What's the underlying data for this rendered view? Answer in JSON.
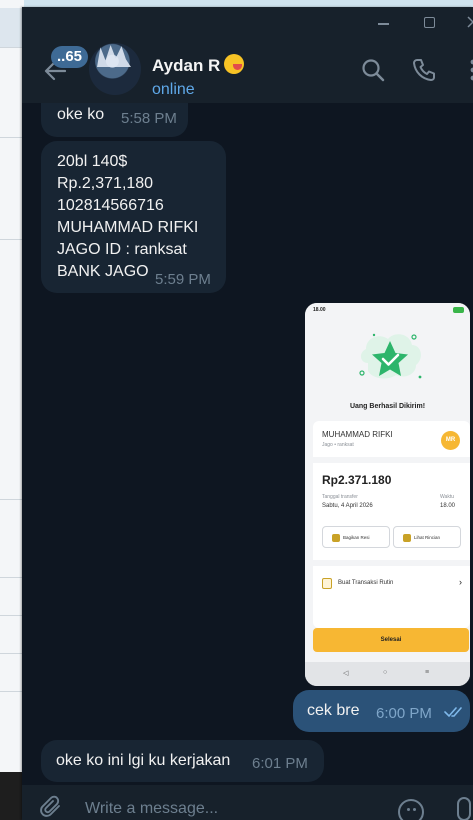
{
  "header": {
    "unread_count": "..65",
    "contact_name": "Aydan R",
    "status": "online"
  },
  "messages": [
    {
      "direction": "incoming",
      "text": "oke ko",
      "time": "5:58 PM"
    },
    {
      "direction": "incoming",
      "lines": [
        "20bl 140$",
        "Rp.2,371,180",
        "102814566716",
        "MUHAMMAD RIFKI",
        "JAGO ID : ranksat",
        "BANK JAGO"
      ],
      "time": "5:59 PM"
    },
    {
      "direction": "outgoing",
      "text": "cek bre",
      "time": "6:00 PM",
      "read": true
    },
    {
      "direction": "incoming",
      "text": "oke ko ini lgi ku kerjakan",
      "time": "6:01 PM"
    }
  ],
  "receipt": {
    "status_time": "18.00",
    "title": "Uang Berhasil Dikirim!",
    "recipient_name": "MUHAMMAD RIFKI",
    "recipient_sub": "Jago • ranksat",
    "initials": "MR",
    "amount": "Rp2.371.180",
    "date_label": "Tanggal transfer",
    "date_value": "Sabtu, 4 April 2026",
    "time_label": "Waktu",
    "time_value": "18.00",
    "share_label": "Bagikan Resi",
    "detail_label": "Lihat Rincian",
    "routine_label": "Buat Transaksi Rutin",
    "done_label": "Selesai"
  },
  "composer": {
    "placeholder": "Write a message..."
  },
  "colors": {
    "chat_bg": "#0e1621",
    "incoming_bubble": "#182533",
    "outgoing_bubble": "#2b5278",
    "accent": "#5fa8e8",
    "receipt_accent": "#f7b733",
    "success_green": "#2db56b"
  }
}
